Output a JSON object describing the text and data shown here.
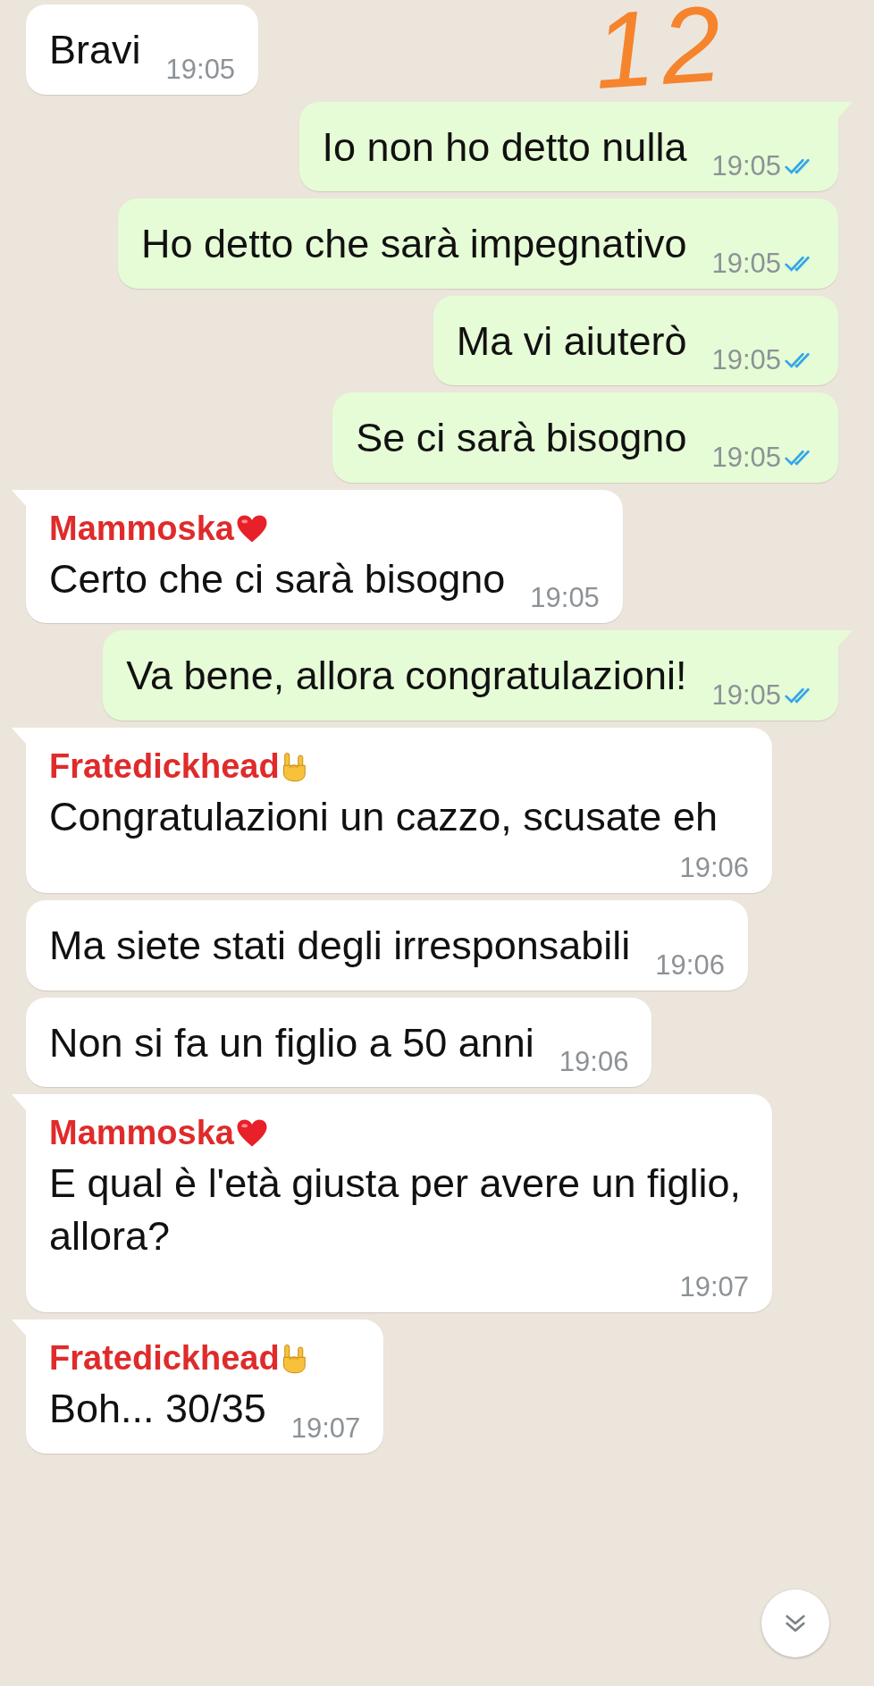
{
  "messages": [
    {
      "kind": "in",
      "tail": false,
      "text": "Bravi",
      "time": "19:05"
    },
    {
      "kind": "out",
      "tail": true,
      "text": "Io non ho detto nulla",
      "time": "19:05",
      "read": true
    },
    {
      "kind": "out",
      "tail": false,
      "text": "Ho detto che sarà impegnativo",
      "time": "19:05",
      "read": true
    },
    {
      "kind": "out",
      "tail": false,
      "text": "Ma vi aiuterò",
      "time": "19:05",
      "read": true
    },
    {
      "kind": "out",
      "tail": false,
      "text": "Se ci sarà bisogno",
      "time": "19:05",
      "read": true
    },
    {
      "kind": "in",
      "tail": true,
      "sender": "Mammoska",
      "badge": {
        "kind": "heart"
      },
      "text": "Certo che ci sarà bisogno",
      "time": "19:05"
    },
    {
      "kind": "out",
      "tail": true,
      "text": "Va bene, allora congratulazioni!",
      "time": "19:05",
      "read": true
    },
    {
      "kind": "in",
      "tail": true,
      "sender": "Fratedickhead",
      "badge": {
        "kind": "horns"
      },
      "text": "Congratulazioni un cazzo, scusate eh",
      "time": "19:06"
    },
    {
      "kind": "in",
      "tail": false,
      "text": "Ma siete stati degli irresponsabili",
      "time": "19:06"
    },
    {
      "kind": "in",
      "tail": false,
      "text": "Non si fa un figlio a 50 anni",
      "time": "19:06"
    },
    {
      "kind": "in",
      "tail": true,
      "sender": "Mammoska",
      "badge": {
        "kind": "heart"
      },
      "text": "E qual è l'età giusta per avere un figlio, allora?",
      "time": "19:07"
    },
    {
      "kind": "in",
      "tail": true,
      "sender": "Fratedickhead",
      "badge": {
        "kind": "horns"
      },
      "text": "Boh... 30/35",
      "time": "19:07"
    }
  ],
  "annotation": {
    "text": "12"
  }
}
